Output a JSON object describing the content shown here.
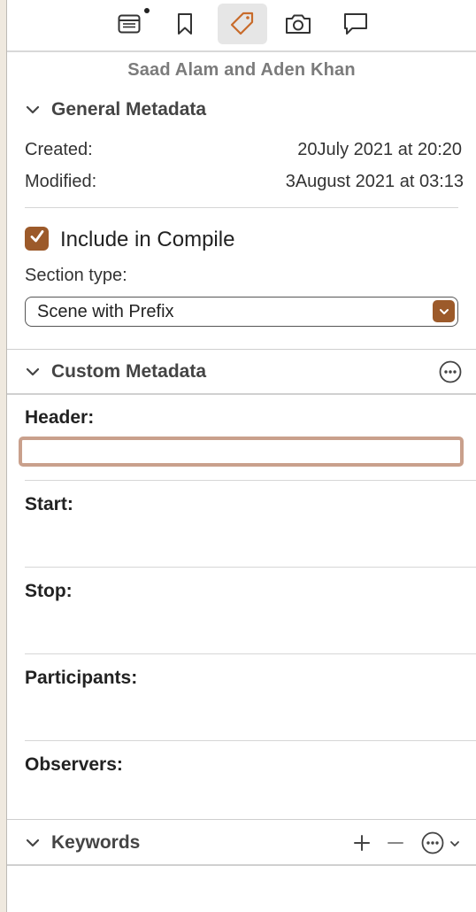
{
  "toolbar": {
    "icons": [
      "notes-icon",
      "bookmark-icon",
      "metadata-tag-icon",
      "snapshot-camera-icon",
      "comment-icon"
    ],
    "active": "metadata-tag-icon",
    "accent": "#c86b2a"
  },
  "document": {
    "title": "Saad Alam and Aden Khan"
  },
  "general": {
    "title": "General Metadata",
    "created_label": "Created:",
    "created_value": "20July 2021 at 20:20",
    "modified_label": "Modified:",
    "modified_value": "3August 2021 at 03:13",
    "include_label": "Include in Compile",
    "include_checked": true,
    "section_type_label": "Section type:",
    "section_type_value": "Scene with Prefix"
  },
  "custom": {
    "title": "Custom Metadata",
    "fields": [
      {
        "label": "Header:",
        "value": ""
      },
      {
        "label": "Start:",
        "value": ""
      },
      {
        "label": "Stop:",
        "value": ""
      },
      {
        "label": "Participants:",
        "value": ""
      },
      {
        "label": "Observers:",
        "value": ""
      }
    ]
  },
  "keywords": {
    "title": "Keywords"
  },
  "colors": {
    "accent_brown": "#9c5a2a",
    "focus_ring": "#c9a08c"
  }
}
